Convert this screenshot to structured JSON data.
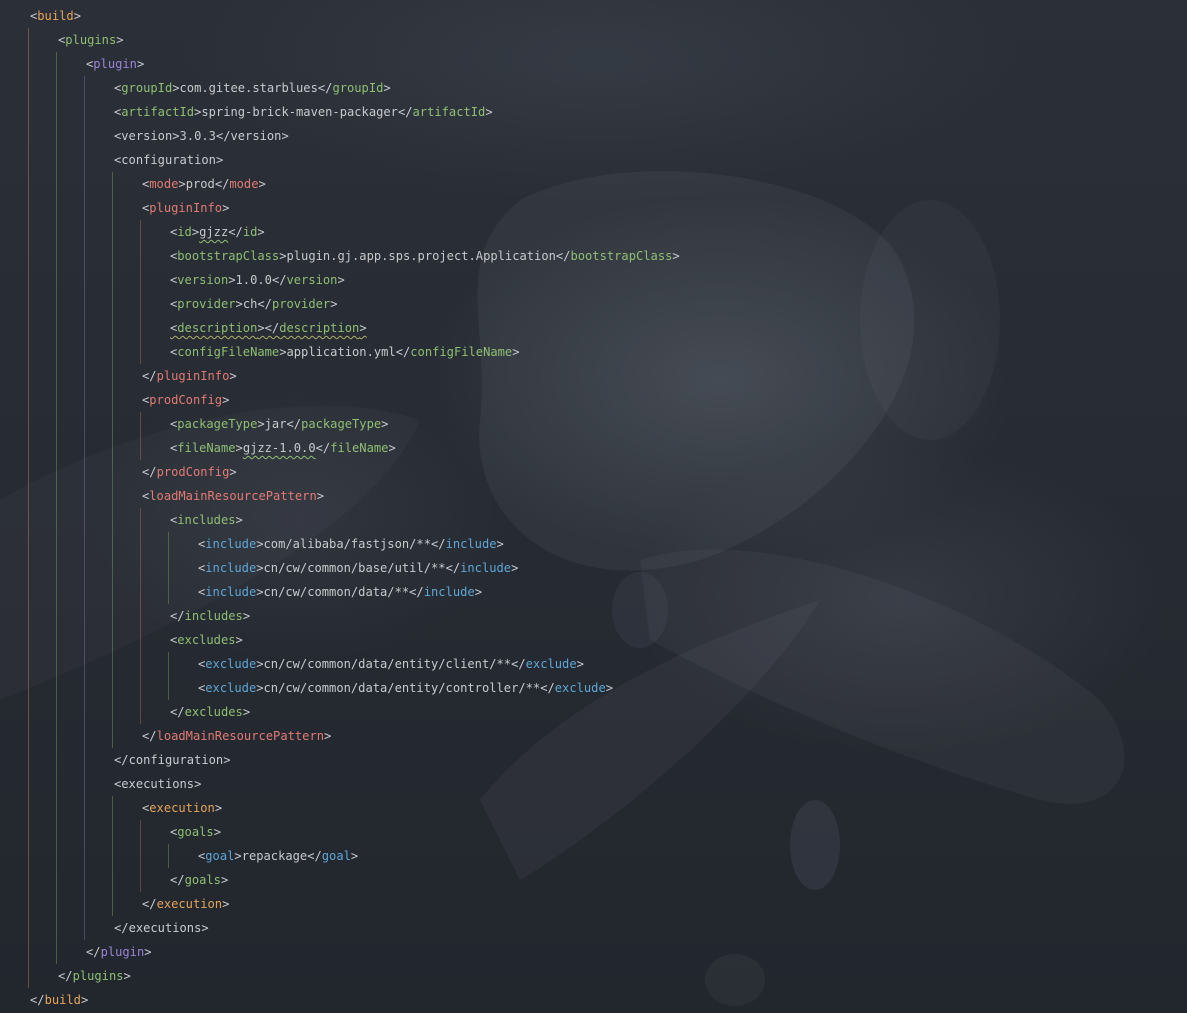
{
  "editor": {
    "language": "xml",
    "lines": [
      {
        "indent": 0,
        "open": "build",
        "text": "",
        "close": "",
        "col": "c-build"
      },
      {
        "indent": 1,
        "open": "plugins",
        "text": "",
        "close": "",
        "col": "c-plugins"
      },
      {
        "indent": 2,
        "open": "plugin",
        "text": "",
        "close": "",
        "col": "c-plugin"
      },
      {
        "indent": 3,
        "open": "groupId",
        "text": "com.gitee.starblues",
        "close": "groupId",
        "col": "c-l3"
      },
      {
        "indent": 3,
        "open": "artifactId",
        "text": "spring-brick-maven-packager",
        "close": "artifactId",
        "col": "c-l3"
      },
      {
        "indent": 3,
        "open": "version",
        "text": "3.0.3",
        "close": "version",
        "col": "c-l3",
        "plain": true
      },
      {
        "indent": 3,
        "open": "configuration",
        "text": "",
        "close": "",
        "col": "c-l3",
        "plain": true
      },
      {
        "indent": 4,
        "open": "mode",
        "text": "prod",
        "close": "mode",
        "col": "c-l4"
      },
      {
        "indent": 4,
        "open": "pluginInfo",
        "text": "",
        "close": "",
        "col": "c-l4"
      },
      {
        "indent": 5,
        "open": "id",
        "text": "gjzz",
        "close": "id",
        "col": "c-l5",
        "wavyText": true
      },
      {
        "indent": 5,
        "open": "bootstrapClass",
        "text": "plugin.gj.app.sps.project.Application",
        "close": "bootstrapClass",
        "col": "c-l5"
      },
      {
        "indent": 5,
        "open": "version",
        "text": "1.0.0",
        "close": "version",
        "col": "c-l5"
      },
      {
        "indent": 5,
        "open": "provider",
        "text": "ch",
        "close": "provider",
        "col": "c-l5"
      },
      {
        "indent": 5,
        "open": "description",
        "text": "",
        "close": "description",
        "col": "c-l5",
        "wavyAll": true
      },
      {
        "indent": 5,
        "open": "configFileName",
        "text": "application.yml",
        "close": "configFileName",
        "col": "c-l5"
      },
      {
        "indent": 4,
        "open": "",
        "text": "",
        "close": "pluginInfo",
        "col": "c-l4",
        "closeOnly": true
      },
      {
        "indent": 4,
        "open": "prodConfig",
        "text": "",
        "close": "",
        "col": "c-l4"
      },
      {
        "indent": 5,
        "open": "packageType",
        "text": "jar",
        "close": "packageType",
        "col": "c-l5"
      },
      {
        "indent": 5,
        "open": "fileName",
        "text": "gjzz-1.0.0",
        "close": "fileName",
        "col": "c-l5",
        "wavyText": true
      },
      {
        "indent": 4,
        "open": "",
        "text": "",
        "close": "prodConfig",
        "col": "c-l4",
        "closeOnly": true
      },
      {
        "indent": 4,
        "open": "loadMainResourcePattern",
        "text": "",
        "close": "",
        "col": "c-l4"
      },
      {
        "indent": 5,
        "open": "includes",
        "text": "",
        "close": "",
        "col": "c-l5"
      },
      {
        "indent": 6,
        "open": "include",
        "text": "com/alibaba/fastjson/**",
        "close": "include",
        "col": "c-l6"
      },
      {
        "indent": 6,
        "open": "include",
        "text": "cn/cw/common/base/util/**",
        "close": "include",
        "col": "c-l6"
      },
      {
        "indent": 6,
        "open": "include",
        "text": "cn/cw/common/data/**",
        "close": "include",
        "col": "c-l6"
      },
      {
        "indent": 5,
        "open": "",
        "text": "",
        "close": "includes",
        "col": "c-l5",
        "closeOnly": true
      },
      {
        "indent": 5,
        "open": "excludes",
        "text": "",
        "close": "",
        "col": "c-l5"
      },
      {
        "indent": 6,
        "open": "exclude",
        "text": "cn/cw/common/data/entity/client/**",
        "close": "exclude",
        "col": "c-l6"
      },
      {
        "indent": 6,
        "open": "exclude",
        "text": "cn/cw/common/data/entity/controller/**",
        "close": "exclude",
        "col": "c-l6"
      },
      {
        "indent": 5,
        "open": "",
        "text": "",
        "close": "excludes",
        "col": "c-l5",
        "closeOnly": true
      },
      {
        "indent": 4,
        "open": "",
        "text": "",
        "close": "loadMainResourcePattern",
        "col": "c-l4",
        "closeOnly": true
      },
      {
        "indent": 3,
        "open": "",
        "text": "",
        "close": "configuration",
        "col": "c-l3",
        "closeOnly": true,
        "plain": true
      },
      {
        "indent": 3,
        "open": "executions",
        "text": "",
        "close": "",
        "col": "c-l3",
        "plain": true
      },
      {
        "indent": 4,
        "open": "execution",
        "text": "",
        "close": "",
        "col": "c-exec"
      },
      {
        "indent": 5,
        "open": "goals",
        "text": "",
        "close": "",
        "col": "c-goals"
      },
      {
        "indent": 6,
        "open": "goal",
        "text": "repackage",
        "close": "goal",
        "col": "c-l6"
      },
      {
        "indent": 5,
        "open": "",
        "text": "",
        "close": "goals",
        "col": "c-goals",
        "closeOnly": true
      },
      {
        "indent": 4,
        "open": "",
        "text": "",
        "close": "execution",
        "col": "c-exec",
        "closeOnly": true
      },
      {
        "indent": 3,
        "open": "",
        "text": "",
        "close": "executions",
        "col": "c-l3",
        "closeOnly": true,
        "plain": true
      },
      {
        "indent": 2,
        "open": "",
        "text": "",
        "close": "plugin",
        "col": "c-plugin",
        "closeOnly": true
      },
      {
        "indent": 1,
        "open": "",
        "text": "",
        "close": "plugins",
        "col": "c-plugins",
        "closeOnly": true
      },
      {
        "indent": 0,
        "open": "",
        "text": "",
        "close": "build",
        "col": "c-build",
        "closeOnly": true
      }
    ]
  },
  "colors": {
    "background": "#252830",
    "bracket": "#c9cbcf",
    "text": "#c7c9cc",
    "build": "#e5a45a",
    "plugins": "#8fbf73",
    "plugin": "#9a85d8",
    "level4": "#e17b73",
    "level6": "#5fa7d6"
  },
  "icons": [
    "background-art-image"
  ]
}
